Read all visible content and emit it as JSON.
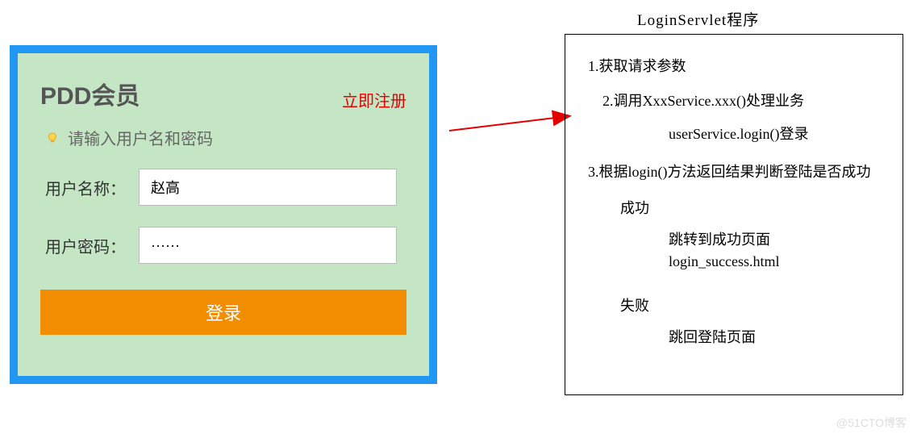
{
  "login": {
    "title": "PDD会员",
    "register": "立即注册",
    "hint": "请输入用户名和密码",
    "username_label": "用户名称：",
    "username_value": "赵高",
    "password_label": "用户密码：",
    "password_value": "······",
    "button": "登录"
  },
  "servlet": {
    "title": "LoginServlet程序",
    "line1": "1.获取请求参数",
    "line2": "2.调用XxxService.xxx()处理业务",
    "line2b": "userService.login()登录",
    "line3": "3.根据login()方法返回结果判断登陆是否成功",
    "success_label": "成功",
    "success_action1": "跳转到成功页面",
    "success_action2": "login_success.html",
    "fail_label": "失败",
    "fail_action": "跳回登陆页面"
  },
  "watermark": "@51CTO博客"
}
